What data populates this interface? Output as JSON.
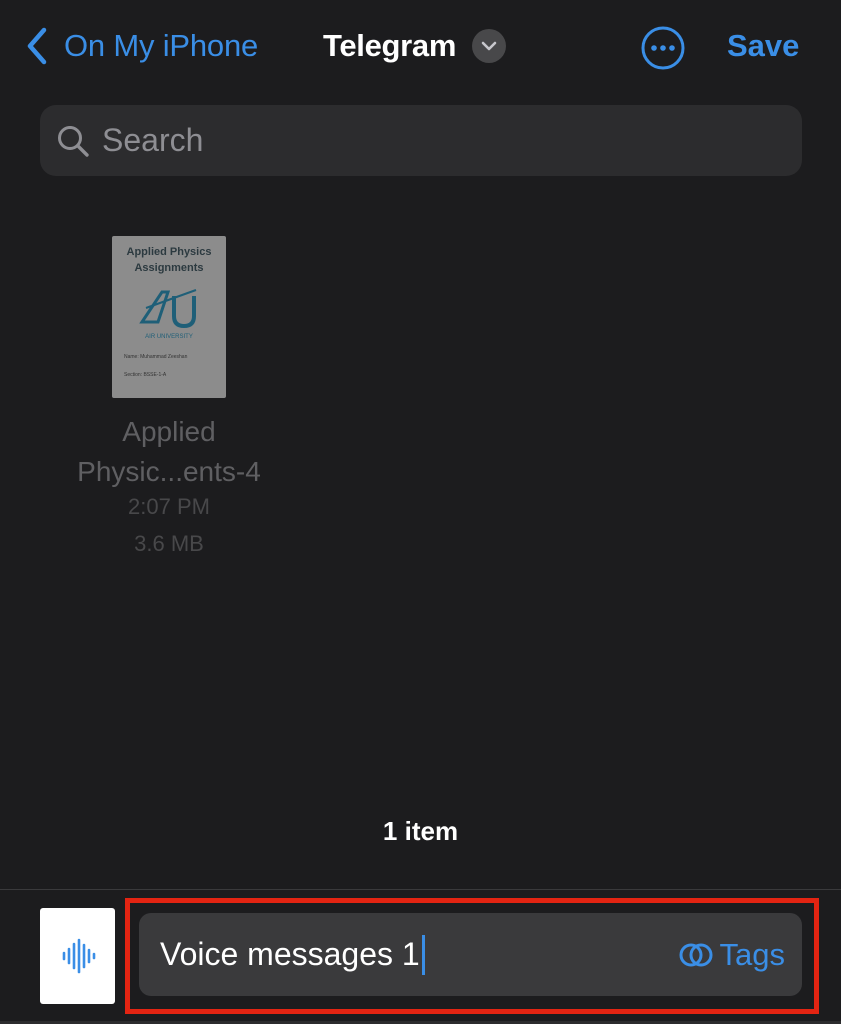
{
  "nav": {
    "back_label": "On My iPhone",
    "title": "Telegram",
    "save_label": "Save"
  },
  "search": {
    "placeholder": "Search"
  },
  "file": {
    "name": "Applied Physic...ents-4",
    "time": "2:07 PM",
    "size": "3.6 MB",
    "thumbnail": {
      "title": "Applied Physics Assignments",
      "logo_text": "AU",
      "university": "AIR UNIVERSITY",
      "name_line": "Name: Muhammad Zeeshan",
      "section_line": "Section: BSSE-1-A"
    }
  },
  "status": {
    "item_count": "1 item"
  },
  "save_bar": {
    "file_name_value": "Voice messages 1",
    "tags_label": "Tags"
  },
  "colors": {
    "accent": "#3a8ee6",
    "background": "#1c1c1e",
    "field": "#3a3a3c",
    "highlight": "#e32412"
  },
  "icons": {
    "back": "chevron-left-icon",
    "title_menu": "chevron-down-icon",
    "more": "ellipsis-circle-icon",
    "search": "magnifying-glass-icon",
    "audio": "waveform-icon",
    "tags": "tags-icon"
  }
}
